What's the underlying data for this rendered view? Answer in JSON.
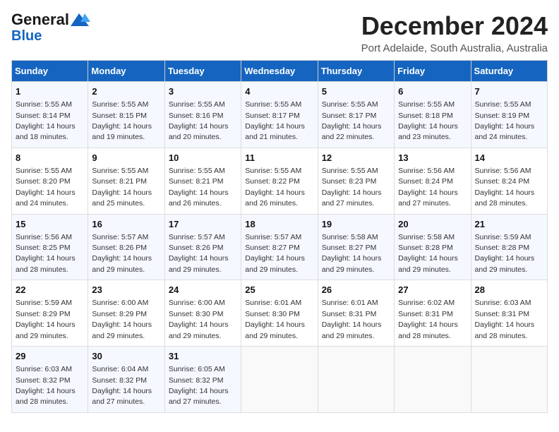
{
  "logo": {
    "general": "General",
    "blue": "Blue"
  },
  "title": "December 2024",
  "subtitle": "Port Adelaide, South Australia, Australia",
  "headers": [
    "Sunday",
    "Monday",
    "Tuesday",
    "Wednesday",
    "Thursday",
    "Friday",
    "Saturday"
  ],
  "weeks": [
    [
      {
        "day": "1",
        "detail": "Sunrise: 5:55 AM\nSunset: 8:14 PM\nDaylight: 14 hours\nand 18 minutes."
      },
      {
        "day": "2",
        "detail": "Sunrise: 5:55 AM\nSunset: 8:15 PM\nDaylight: 14 hours\nand 19 minutes."
      },
      {
        "day": "3",
        "detail": "Sunrise: 5:55 AM\nSunset: 8:16 PM\nDaylight: 14 hours\nand 20 minutes."
      },
      {
        "day": "4",
        "detail": "Sunrise: 5:55 AM\nSunset: 8:17 PM\nDaylight: 14 hours\nand 21 minutes."
      },
      {
        "day": "5",
        "detail": "Sunrise: 5:55 AM\nSunset: 8:17 PM\nDaylight: 14 hours\nand 22 minutes."
      },
      {
        "day": "6",
        "detail": "Sunrise: 5:55 AM\nSunset: 8:18 PM\nDaylight: 14 hours\nand 23 minutes."
      },
      {
        "day": "7",
        "detail": "Sunrise: 5:55 AM\nSunset: 8:19 PM\nDaylight: 14 hours\nand 24 minutes."
      }
    ],
    [
      {
        "day": "8",
        "detail": "Sunrise: 5:55 AM\nSunset: 8:20 PM\nDaylight: 14 hours\nand 24 minutes."
      },
      {
        "day": "9",
        "detail": "Sunrise: 5:55 AM\nSunset: 8:21 PM\nDaylight: 14 hours\nand 25 minutes."
      },
      {
        "day": "10",
        "detail": "Sunrise: 5:55 AM\nSunset: 8:21 PM\nDaylight: 14 hours\nand 26 minutes."
      },
      {
        "day": "11",
        "detail": "Sunrise: 5:55 AM\nSunset: 8:22 PM\nDaylight: 14 hours\nand 26 minutes."
      },
      {
        "day": "12",
        "detail": "Sunrise: 5:55 AM\nSunset: 8:23 PM\nDaylight: 14 hours\nand 27 minutes."
      },
      {
        "day": "13",
        "detail": "Sunrise: 5:56 AM\nSunset: 8:24 PM\nDaylight: 14 hours\nand 27 minutes."
      },
      {
        "day": "14",
        "detail": "Sunrise: 5:56 AM\nSunset: 8:24 PM\nDaylight: 14 hours\nand 28 minutes."
      }
    ],
    [
      {
        "day": "15",
        "detail": "Sunrise: 5:56 AM\nSunset: 8:25 PM\nDaylight: 14 hours\nand 28 minutes."
      },
      {
        "day": "16",
        "detail": "Sunrise: 5:57 AM\nSunset: 8:26 PM\nDaylight: 14 hours\nand 29 minutes."
      },
      {
        "day": "17",
        "detail": "Sunrise: 5:57 AM\nSunset: 8:26 PM\nDaylight: 14 hours\nand 29 minutes."
      },
      {
        "day": "18",
        "detail": "Sunrise: 5:57 AM\nSunset: 8:27 PM\nDaylight: 14 hours\nand 29 minutes."
      },
      {
        "day": "19",
        "detail": "Sunrise: 5:58 AM\nSunset: 8:27 PM\nDaylight: 14 hours\nand 29 minutes."
      },
      {
        "day": "20",
        "detail": "Sunrise: 5:58 AM\nSunset: 8:28 PM\nDaylight: 14 hours\nand 29 minutes."
      },
      {
        "day": "21",
        "detail": "Sunrise: 5:59 AM\nSunset: 8:28 PM\nDaylight: 14 hours\nand 29 minutes."
      }
    ],
    [
      {
        "day": "22",
        "detail": "Sunrise: 5:59 AM\nSunset: 8:29 PM\nDaylight: 14 hours\nand 29 minutes."
      },
      {
        "day": "23",
        "detail": "Sunrise: 6:00 AM\nSunset: 8:29 PM\nDaylight: 14 hours\nand 29 minutes."
      },
      {
        "day": "24",
        "detail": "Sunrise: 6:00 AM\nSunset: 8:30 PM\nDaylight: 14 hours\nand 29 minutes."
      },
      {
        "day": "25",
        "detail": "Sunrise: 6:01 AM\nSunset: 8:30 PM\nDaylight: 14 hours\nand 29 minutes."
      },
      {
        "day": "26",
        "detail": "Sunrise: 6:01 AM\nSunset: 8:31 PM\nDaylight: 14 hours\nand 29 minutes."
      },
      {
        "day": "27",
        "detail": "Sunrise: 6:02 AM\nSunset: 8:31 PM\nDaylight: 14 hours\nand 28 minutes."
      },
      {
        "day": "28",
        "detail": "Sunrise: 6:03 AM\nSunset: 8:31 PM\nDaylight: 14 hours\nand 28 minutes."
      }
    ],
    [
      {
        "day": "29",
        "detail": "Sunrise: 6:03 AM\nSunset: 8:32 PM\nDaylight: 14 hours\nand 28 minutes."
      },
      {
        "day": "30",
        "detail": "Sunrise: 6:04 AM\nSunset: 8:32 PM\nDaylight: 14 hours\nand 27 minutes."
      },
      {
        "day": "31",
        "detail": "Sunrise: 6:05 AM\nSunset: 8:32 PM\nDaylight: 14 hours\nand 27 minutes."
      },
      null,
      null,
      null,
      null
    ]
  ]
}
